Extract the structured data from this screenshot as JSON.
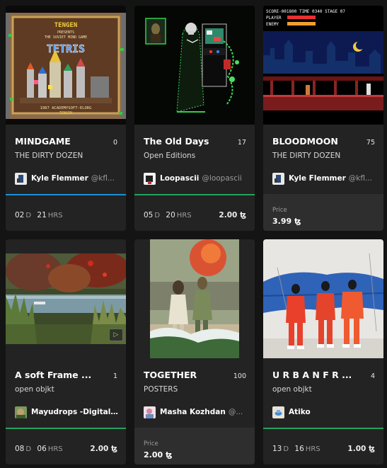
{
  "cards": [
    {
      "title": "MINDGAME",
      "edition": "0",
      "collection": "THE DIRTY DOZEN",
      "artist_name": "Kyle Flemmer",
      "artist_handle": "@kfl...",
      "footer": {
        "type": "timer",
        "days": "02",
        "days_unit": "D",
        "hours": "21",
        "hours_unit": "HRS",
        "price": ""
      },
      "thumbnail": {
        "icon": "retro-game-title-screen-image",
        "text_lines": [
          "TENGEN",
          "PRESENTS",
          "THE SOVIET MIND GAME",
          "TETRIS",
          "TENGEN",
          "1987 ACADEMYSOFT-ELORG",
          "TENGEN"
        ]
      }
    },
    {
      "title": "The Old Days",
      "edition": "17",
      "collection": "Open Editions",
      "artist_name": "Loopascii",
      "artist_handle": "@loopascii",
      "footer": {
        "type": "timer",
        "days": "05",
        "days_unit": "D",
        "hours": "20",
        "hours_unit": "HRS",
        "price": "2.00 ꜩ"
      },
      "thumbnail": {
        "icon": "arcade-skeleton-art-image"
      }
    },
    {
      "title": "BLOODMOON",
      "edition": "75",
      "collection": "THE DIRTY DOZEN",
      "artist_name": "Kyle Flemmer",
      "artist_handle": "@kfl...",
      "footer": {
        "type": "price",
        "label": "Price",
        "price": "3.99 ꜩ"
      },
      "thumbnail": {
        "icon": "retro-game-castle-level-image",
        "text_lines": [
          "SCORE-001800 TIME 0340 STAGE 07",
          "PLAYER",
          "ENEMY"
        ]
      }
    },
    {
      "title": "A soft Frame ...",
      "edition": "1",
      "collection": "open objkt",
      "artist_name": "Mayudrops -Digital...",
      "artist_handle": "",
      "footer": {
        "type": "timer",
        "days": "08",
        "days_unit": "D",
        "hours": "06",
        "hours_unit": "HRS",
        "price": "2.00 ꜩ"
      },
      "thumbnail": {
        "icon": "pond-landscape-photo-image",
        "play_icon": "play-icon"
      }
    },
    {
      "title": "TOGETHER",
      "edition": "100",
      "collection": "POSTERS",
      "artist_name": "Masha Kozhdan",
      "artist_handle": "@...",
      "footer": {
        "type": "price",
        "label": "Price",
        "price": "2.00 ꜩ"
      },
      "thumbnail": {
        "icon": "collage-couple-image"
      }
    },
    {
      "title": "U R B A N F R ...",
      "edition": "4",
      "collection": "open objkt",
      "artist_name": "Atiko",
      "artist_handle": "",
      "footer": {
        "type": "timer",
        "days": "13",
        "days_unit": "D",
        "hours": "16",
        "hours_unit": "HRS",
        "price": "1.00 ꜩ"
      },
      "thumbnail": {
        "icon": "urban-figures-painting-image"
      }
    }
  ],
  "colors": {
    "background": "#141414",
    "card": "#232323",
    "accent_green": "#26a25d",
    "accent_blue": "#1d8fd6"
  }
}
